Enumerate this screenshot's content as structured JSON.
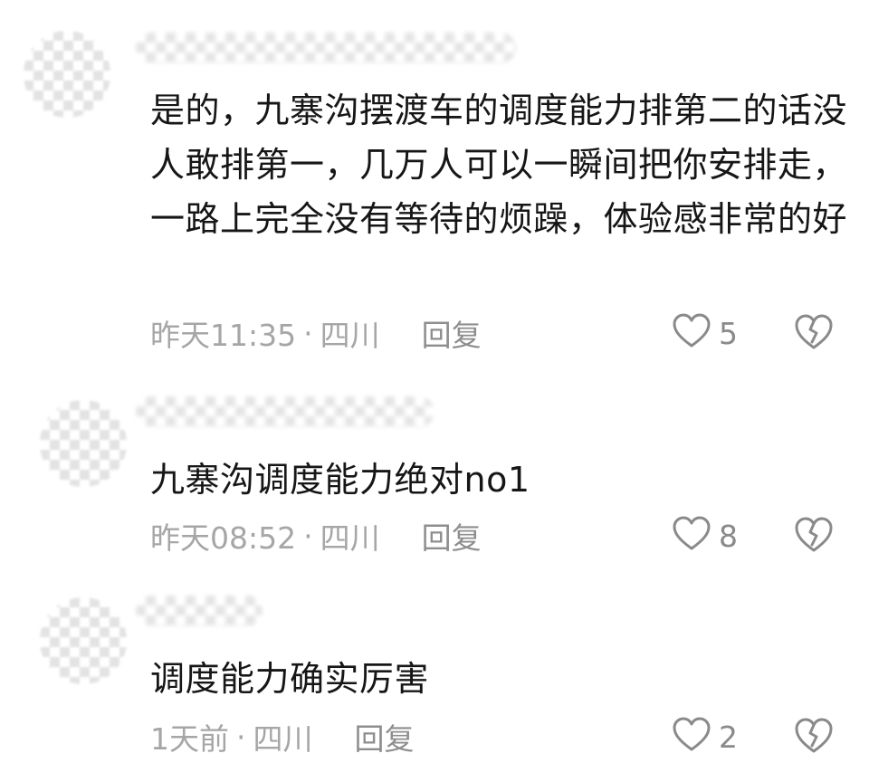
{
  "comments": [
    {
      "text": "是的，九寨沟摆渡车的调度能力排第二的话没人敢排第一，几万人可以一瞬间把你安排走，一路上完全没有等待的烦躁，体验感非常的好",
      "time": "昨天11:35",
      "separator": "·",
      "location": "四川",
      "reply_label": "回复",
      "likes": "5"
    },
    {
      "text": "九寨沟调度能力绝对no1",
      "time": "昨天08:52",
      "separator": "·",
      "location": "四川",
      "reply_label": "回复",
      "likes": "8"
    },
    {
      "text": "调度能力确实厉害",
      "time": "1天前",
      "separator": "·",
      "location": "四川",
      "reply_label": "回复",
      "likes": "2"
    }
  ],
  "icons": {
    "like": "heart-outline-icon",
    "dislike": "broken-heart-icon"
  },
  "colors": {
    "text": "#161616",
    "meta": "#a6a6a6",
    "icon": "#8a8a8a"
  }
}
